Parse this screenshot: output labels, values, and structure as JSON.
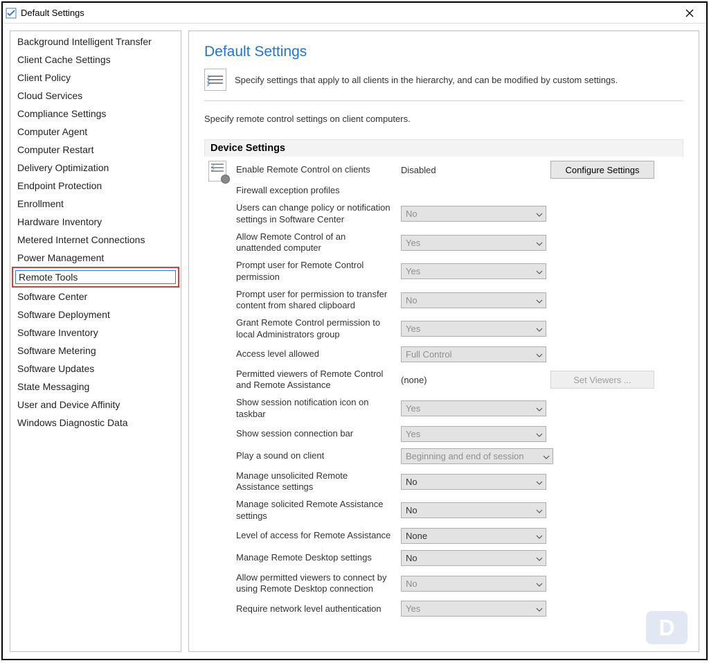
{
  "window": {
    "title": "Default Settings"
  },
  "sidebar": {
    "items": [
      "Background Intelligent Transfer",
      "Client Cache Settings",
      "Client Policy",
      "Cloud Services",
      "Compliance Settings",
      "Computer Agent",
      "Computer Restart",
      "Delivery Optimization",
      "Endpoint Protection",
      "Enrollment",
      "Hardware Inventory",
      "Metered Internet Connections",
      "Power Management",
      "Remote Tools",
      "Software Center",
      "Software Deployment",
      "Software Inventory",
      "Software Metering",
      "Software Updates",
      "State Messaging",
      "User and Device Affinity",
      "Windows Diagnostic Data"
    ],
    "selected_index": 13
  },
  "main": {
    "heading": "Default Settings",
    "intro": "Specify settings that apply to all clients in the hierarchy, and can be modified by custom settings.",
    "subtext": "Specify remote control settings on client computers.",
    "section_title": "Device Settings",
    "configure_button": "Configure Settings",
    "set_viewers_button": "Set Viewers ...",
    "settings": [
      {
        "label": "Enable Remote Control on clients",
        "value": "Disabled",
        "type": "text_with_button"
      },
      {
        "label": "Firewall exception profiles",
        "value": "",
        "type": "blank"
      },
      {
        "label": "Users can change policy or notification settings in Software Center",
        "value": "No",
        "type": "combo_disabled"
      },
      {
        "label": "Allow Remote Control of an unattended computer",
        "value": "Yes",
        "type": "combo_disabled"
      },
      {
        "label": "Prompt user for Remote Control permission",
        "value": "Yes",
        "type": "combo_disabled"
      },
      {
        "label": "Prompt user for permission to transfer content from shared clipboard",
        "value": "No",
        "type": "combo_disabled"
      },
      {
        "label": "Grant Remote Control permission to local Administrators group",
        "value": "Yes",
        "type": "combo_disabled"
      },
      {
        "label": "Access level allowed",
        "value": "Full Control",
        "type": "combo_disabled"
      },
      {
        "label": "Permitted viewers of Remote Control and Remote Assistance",
        "value": "(none)",
        "type": "text_with_setviewers"
      },
      {
        "label": "Show session notification icon on taskbar",
        "value": "Yes",
        "type": "combo_disabled"
      },
      {
        "label": "Show session connection bar",
        "value": "Yes",
        "type": "combo_disabled"
      },
      {
        "label": "Play a sound on client",
        "value": "Beginning and end of session",
        "type": "combo_disabled_wide"
      },
      {
        "label": "Manage unsolicited Remote Assistance settings",
        "value": "No",
        "type": "combo"
      },
      {
        "label": "Manage solicited Remote Assistance settings",
        "value": "No",
        "type": "combo"
      },
      {
        "label": "Level of access for Remote Assistance",
        "value": "None",
        "type": "combo"
      },
      {
        "label": "Manage Remote Desktop settings",
        "value": "No",
        "type": "combo"
      },
      {
        "label": "Allow permitted viewers to connect by using Remote Desktop connection",
        "value": "No",
        "type": "combo_disabled"
      },
      {
        "label": "Require network level authentication",
        "value": "Yes",
        "type": "combo_disabled"
      }
    ]
  }
}
